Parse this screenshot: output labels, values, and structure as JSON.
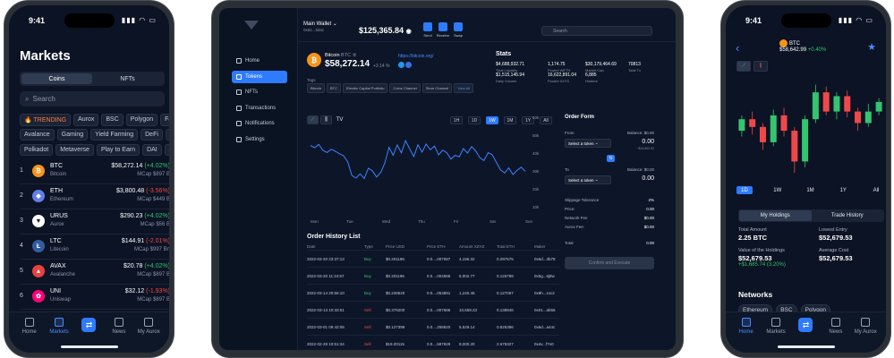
{
  "left_phone": {
    "time": "9:41",
    "title": "Markets",
    "segments": [
      "Coins",
      "NFTs"
    ],
    "active_segment": "Coins",
    "search_placeholder": "Search",
    "chips_row1": [
      "🔥 TRENDING",
      "Aurox",
      "BSC",
      "Polygon",
      "Fantom"
    ],
    "chips_row2": [
      "Avalance",
      "Gaming",
      "Yield Farming",
      "DeFi",
      "NFT"
    ],
    "chips_row3": [
      "Polkadot",
      "Metaverse",
      "Play to Earn",
      "DAI",
      "Avalanche"
    ],
    "coins": [
      {
        "rank": "1",
        "symbol": "BTC",
        "name": "Bitcoin",
        "price": "$58,272.14",
        "change": "(+4.02%)",
        "dir": "up",
        "mcap": "MCap $897 B",
        "color": "#f7931a",
        "glyph": "₿"
      },
      {
        "rank": "2",
        "symbol": "ETH",
        "name": "Ethereum",
        "price": "$3,800.48",
        "change": "(-3.56%)",
        "dir": "dn",
        "mcap": "MCap $449 B",
        "color": "#627eea",
        "glyph": "◆"
      },
      {
        "rank": "3",
        "symbol": "URUS",
        "name": "Aurox",
        "price": "$290.23",
        "change": "(+4.02%)",
        "dir": "up",
        "mcap": "MCap $56 B",
        "color": "#ffffff",
        "glyph": "▼"
      },
      {
        "rank": "4",
        "symbol": "LTC",
        "name": "Litecoin",
        "price": "$144.91",
        "change": "(-2.01%)",
        "dir": "dn",
        "mcap": "MCap $997 Bn",
        "color": "#345d9d",
        "glyph": "Ł"
      },
      {
        "rank": "5",
        "symbol": "AVAX",
        "name": "Avalanche",
        "price": "$20.78",
        "change": "(+4.02%)",
        "dir": "up",
        "mcap": "MCap $897 B",
        "color": "#e84142",
        "glyph": "▲"
      },
      {
        "rank": "6",
        "symbol": "UNI",
        "name": "Uniswap",
        "price": "$32.12",
        "change": "(-1.93%)",
        "dir": "dn",
        "mcap": "MCap $897 B",
        "color": "#ff007a",
        "glyph": "✿"
      }
    ],
    "tabs": [
      "Home",
      "Markets",
      "",
      "News",
      "My Aurox"
    ],
    "active_tab": "Markets"
  },
  "tablet": {
    "nav": [
      "Home",
      "Tokens",
      "NFTs",
      "Transactions",
      "Notifications",
      "Settings"
    ],
    "active_nav": "Tokens",
    "wallet_name": "Main Wallet",
    "wallet_sub": "0x81...5d4c",
    "balance": "$125,365.84",
    "header_buttons": [
      "Send",
      "Receive",
      "Swap"
    ],
    "search_placeholder": "Search",
    "token_name": "Bitcoin",
    "token_symbol": "BTC",
    "token_price": "$58,272.14",
    "token_change": "+3.14 %",
    "token_link": "https://bitcoin.org/",
    "tags_label": "Tags",
    "tags": [
      "Bitcoin",
      "BTC",
      "Electric Capital Portfolio",
      "Coins Channel",
      "Store Channel"
    ],
    "tags_more": "View All",
    "stats_title": "Stats",
    "stats": [
      {
        "value": "$4,688,932.71",
        "label": "Total Liquidity"
      },
      {
        "value": "1,174.75",
        "label": "Pooled WETH"
      },
      {
        "value": "$30,179,464.69",
        "label": "Market Cap"
      },
      {
        "value": "70813",
        "label": "Total Tx"
      },
      {
        "value": "$1,515,145.94",
        "label": "Daily Volume"
      },
      {
        "value": "16,622,891.04",
        "label": "Pooled XZYS"
      },
      {
        "value": "6,885",
        "label": "Holders"
      }
    ],
    "timeframes": [
      "1H",
      "1D",
      "1W",
      "1M",
      "1Y",
      "All"
    ],
    "active_timeframe": "1W",
    "chart_data": {
      "type": "line",
      "x_labels": [
        "Mon",
        "Tue",
        "Wed",
        "Thu",
        "Fri",
        "Sat",
        "Sun"
      ],
      "y_labels": [
        "60k",
        "50k",
        "40k",
        "30k",
        "20k",
        "10k"
      ],
      "values": [
        44.2,
        43.0,
        44.8,
        41.5,
        40.3,
        42.1,
        41.0,
        39.6,
        38.5,
        35.2,
        27.5,
        26.0,
        28.4,
        25.8,
        31.5,
        30.1,
        26.6,
        29.2,
        34.5,
        43.2,
        38.8,
        44.5,
        40.1,
        47.0,
        42.3,
        38.0,
        44.6,
        40.5,
        45.0,
        41.8,
        43.9,
        39.0,
        41.6,
        40.2,
        36.6,
        38.7,
        37.9,
        42.5,
        40.0,
        43.6,
        41.2,
        37.4,
        35.8,
        40.2,
        39.0,
        34.8,
        30.6,
        28.9,
        31.7,
        28.0,
        30.3,
        32.1,
        29.8
      ]
    },
    "order_form": {
      "title": "Order Form",
      "from_label": "From",
      "from_balance": "Balance: $0.00",
      "from_select": "Select a token",
      "from_amount": "0.00",
      "from_sub": "~$19,502.02",
      "to_label": "To",
      "to_balance": "Balance: $0.00",
      "to_select": "Select a token",
      "to_amount": "0.00",
      "rows": [
        {
          "label": "Slippage Tolerance",
          "value": "2%"
        },
        {
          "label": "Price:",
          "value": "0.00"
        },
        {
          "label": "Network Fee",
          "value": "$0.00"
        },
        {
          "label": "Aurox Fee:",
          "value": "$0.00"
        },
        {
          "label": "Total",
          "value": "0.00"
        }
      ],
      "confirm_label": "Confirm and Execute"
    },
    "history_title": "Order History List",
    "history_headers": [
      "Date",
      "Type",
      "Price USD",
      "Price ETH",
      "Amount XZYZ",
      "Total ETH",
      "Maker"
    ],
    "history": [
      {
        "date": "2022-03-20 23:37:13",
        "type": "Buy",
        "usd": "$0.201196",
        "eth": "0.0....007087",
        "amt": "4,196.32",
        "tot": "0.297575",
        "maker": "0x6d...3b78"
      },
      {
        "date": "2022-03-20 11:24:57",
        "type": "Buy",
        "usd": "$0.201196",
        "eth": "0.0....004586",
        "amt": "6,002.77",
        "tot": "0.126789",
        "maker": "0x5g...6j8w"
      },
      {
        "date": "2022-03-14 20:56:10",
        "type": "Buy",
        "usd": "$0.228520",
        "eth": "0.0....053891",
        "amt": "1,240.45",
        "tot": "0.127097",
        "maker": "0x9h...zxc2"
      },
      {
        "date": "2022-03-13 10:33:51",
        "type": "Sell",
        "usd": "$0.376200",
        "eth": "0.0....007586",
        "amt": "10,658.23",
        "tot": "0.138946",
        "maker": "0x01...ab56"
      },
      {
        "date": "2022-03-01 09:42:05",
        "type": "Sell",
        "usd": "$0.127398",
        "eth": "0.0....258620",
        "amt": "5,529.14",
        "tot": "0.825396",
        "maker": "0x6d...a44c"
      },
      {
        "date": "2022-02-28 10:51:34",
        "type": "Sell",
        "usd": "$19.20115",
        "eth": "0.0....587929",
        "amt": "9,000.20",
        "tot": "2.678327",
        "maker": "0x4v...f7n0"
      }
    ]
  },
  "right_phone": {
    "time": "9:41",
    "coin_label": "BTC",
    "price": "$58,642.99",
    "change": "+0.40%",
    "timeframes": [
      "1D",
      "1W",
      "1M",
      "1Y",
      "All"
    ],
    "active_timeframe": "1D",
    "segments": [
      "My Holdings",
      "Trade History"
    ],
    "active_segment": "My Holdings",
    "total_amount_label": "Total Amount",
    "total_amount": "2.25 BTC",
    "lowest_entry_label": "Lowest Entry",
    "lowest_entry": "$52,679.53",
    "holdings_label": "Value of the Holdings",
    "holdings": "$52,679.53",
    "holdings_change": "+$1,685.74 (3.20%)",
    "avg_cost_label": "Average Cost",
    "avg_cost": "$52,679.53",
    "networks_title": "Networks",
    "networks": [
      "Ethereum",
      "BSC",
      "Polygon"
    ],
    "tabs": [
      "Home",
      "Markets",
      "",
      "News",
      "My Aurox"
    ],
    "active_tab": "Home",
    "candles": [
      {
        "o": 52,
        "c": 58,
        "h": 60,
        "l": 49
      },
      {
        "o": 58,
        "c": 54,
        "h": 62,
        "l": 50
      },
      {
        "o": 54,
        "c": 46,
        "h": 56,
        "l": 42
      },
      {
        "o": 46,
        "c": 60,
        "h": 63,
        "l": 44
      },
      {
        "o": 60,
        "c": 52,
        "h": 64,
        "l": 49
      },
      {
        "o": 52,
        "c": 36,
        "h": 54,
        "l": 30
      },
      {
        "o": 36,
        "c": 58,
        "h": 60,
        "l": 33
      },
      {
        "o": 58,
        "c": 72,
        "h": 76,
        "l": 56
      },
      {
        "o": 72,
        "c": 62,
        "h": 75,
        "l": 60
      },
      {
        "o": 62,
        "c": 70,
        "h": 72,
        "l": 58
      },
      {
        "o": 70,
        "c": 62,
        "h": 73,
        "l": 59
      },
      {
        "o": 62,
        "c": 56,
        "h": 64,
        "l": 52
      },
      {
        "o": 56,
        "c": 62,
        "h": 66,
        "l": 54
      },
      {
        "o": 62,
        "c": 67,
        "h": 69,
        "l": 60
      }
    ]
  }
}
